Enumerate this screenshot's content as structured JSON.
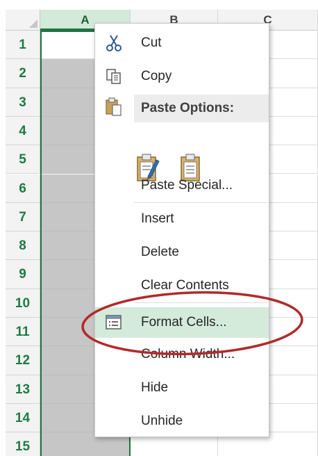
{
  "sheet": {
    "columns": [
      {
        "label": "A",
        "selected": true
      },
      {
        "label": "B",
        "selected": false
      },
      {
        "label": "C",
        "selected": false
      }
    ],
    "rows": [
      "1",
      "2",
      "3",
      "4",
      "5",
      "6",
      "7",
      "8",
      "9",
      "10",
      "11",
      "12",
      "13",
      "14",
      "15"
    ]
  },
  "menu": {
    "items": [
      {
        "label": "Cut",
        "icon": "scissors-icon"
      },
      {
        "label": "Copy",
        "icon": "copy-icon"
      },
      {
        "label": "Paste Options:",
        "icon": "clipboard-icon"
      },
      {
        "label": "Paste Special...",
        "icon": ""
      },
      {
        "label": "Insert",
        "icon": ""
      },
      {
        "label": "Delete",
        "icon": ""
      },
      {
        "label": "Clear Contents",
        "icon": ""
      },
      {
        "label": "Format Cells...",
        "icon": "format-cells-icon"
      },
      {
        "label": "Column Width...",
        "icon": ""
      },
      {
        "label": "Hide",
        "icon": ""
      },
      {
        "label": "Unhide",
        "icon": ""
      }
    ],
    "paste_option_icons": [
      "paste-formatting-icon",
      "paste-values-icon"
    ]
  },
  "colors": {
    "excel_green": "#217346",
    "row_number": "#1e7a45",
    "selection_fill": "#c6c6c6",
    "hover_fill": "#d4ebdb",
    "annotation_red": "#b22a2a"
  }
}
